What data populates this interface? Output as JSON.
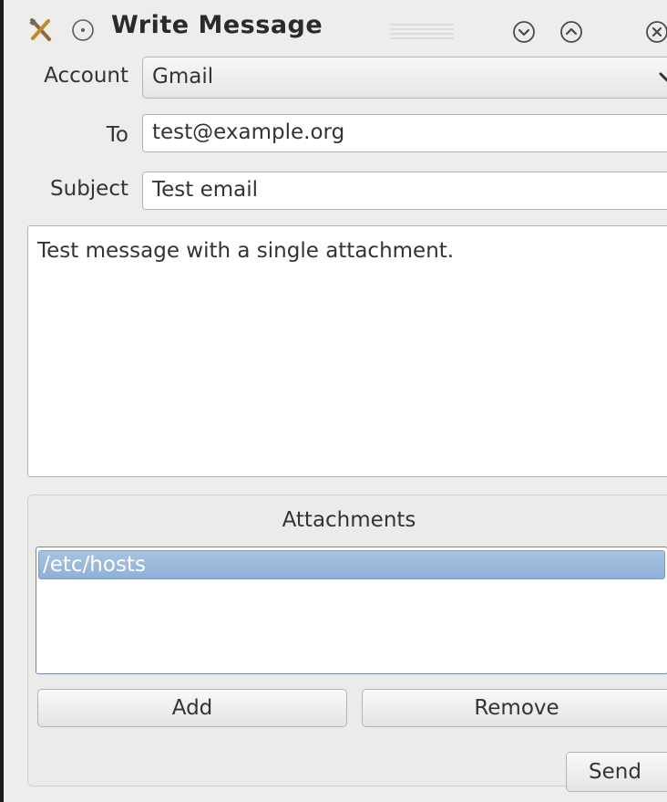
{
  "window": {
    "title": "Write Message",
    "icons": {
      "app": "tools-icon",
      "sticky": "sticky-icon",
      "shade_down": "chevron-down-circle-icon",
      "shade_up": "chevron-up-circle-icon",
      "close": "close-circle-icon"
    }
  },
  "form": {
    "account_label": "Account",
    "account_value": "Gmail",
    "to_label": "To",
    "to_value": "test@example.org",
    "subject_label": "Subject",
    "subject_value": "Test email"
  },
  "message": {
    "body": "Test message with a single attachment."
  },
  "attachments": {
    "title": "Attachments",
    "items": [
      "/etc/hosts"
    ],
    "add_label": "Add",
    "remove_label": "Remove"
  },
  "actions": {
    "send_label": "Send"
  },
  "colors": {
    "window_bg": "#ededec",
    "selection": "#8fb0d6",
    "border": "#b4b4b2"
  }
}
